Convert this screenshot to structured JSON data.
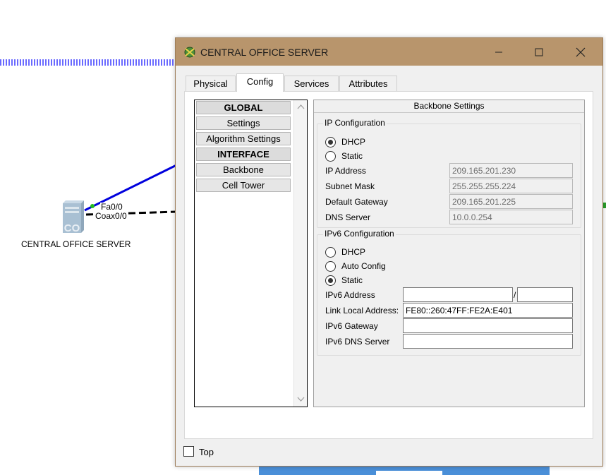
{
  "workspace": {
    "device_label": "CENTRAL OFFICE SERVER",
    "port_fa": "Fa0/0",
    "port_coax": "Coax0/0",
    "icon_text": "CO"
  },
  "window": {
    "title": "CENTRAL OFFICE SERVER",
    "tabs": [
      {
        "label": "Physical"
      },
      {
        "label": "Config"
      },
      {
        "label": "Services"
      },
      {
        "label": "Attributes"
      }
    ],
    "active_tab": "Config",
    "nav": {
      "items": [
        {
          "label": "GLOBAL",
          "header": true
        },
        {
          "label": "Settings"
        },
        {
          "label": "Algorithm Settings"
        },
        {
          "label": "INTERFACE",
          "header": true
        },
        {
          "label": "Backbone"
        },
        {
          "label": "Cell Tower"
        }
      ]
    },
    "settings": {
      "title": "Backbone Settings",
      "ip": {
        "legend": "IP Configuration",
        "dhcp_label": "DHCP",
        "static_label": "Static",
        "selected": "DHCP",
        "ip_address_label": "IP Address",
        "ip_address": "209.165.201.230",
        "subnet_mask_label": "Subnet Mask",
        "subnet_mask": "255.255.255.224",
        "gateway_label": "Default Gateway",
        "gateway": "209.165.201.225",
        "dns_label": "DNS Server",
        "dns": "10.0.0.254"
      },
      "ipv6": {
        "legend": "IPv6 Configuration",
        "dhcp_label": "DHCP",
        "auto_label": "Auto Config",
        "static_label": "Static",
        "selected": "Static",
        "address_label": "IPv6 Address",
        "address": "",
        "prefix": "",
        "prefix_separator": "/",
        "link_local_label": "Link Local Address:",
        "link_local": "FE80::260:47FF:FE2A:E401",
        "gateway_label": "IPv6 Gateway",
        "gateway": "",
        "dns_label": "IPv6 DNS Server",
        "dns": ""
      }
    },
    "top_checkbox": {
      "label": "Top",
      "checked": false
    }
  },
  "colors": {
    "titlebar": "#b8956c",
    "link_blue": "#0000dd",
    "dotted_band": "#6a6aff",
    "bottom_bar": "#4a8fd8"
  }
}
